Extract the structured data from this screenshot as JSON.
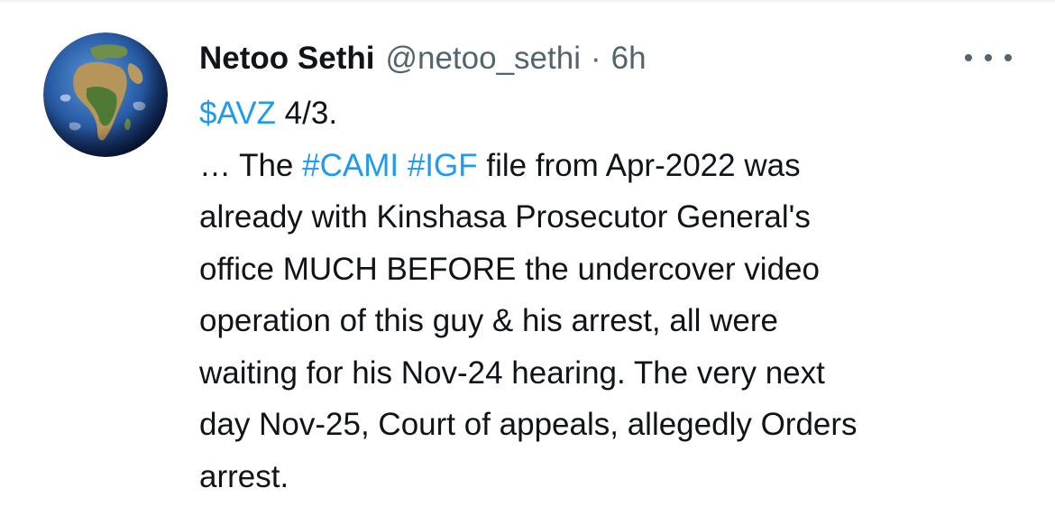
{
  "author": {
    "name": "Netoo Sethi",
    "handle": "@netoo_sethi",
    "separator": "·",
    "time": "6h"
  },
  "avatar_icon": "earth-globe-africa",
  "menu_icon": "more-horizontal-icon",
  "colors": {
    "link": "#1d9bf0",
    "text": "#0f1419",
    "secondary": "#536471"
  },
  "tweet": {
    "cashtag": "$AVZ",
    "line1_rest": " 4/3.",
    "line2_pre": "… The ",
    "hashtag1": "#CAMI",
    "line2_space": " ",
    "hashtag2": "#IGF",
    "line2_post": " file from Apr-2022 was",
    "line3": "already with Kinshasa Prosecutor General's",
    "line4": "office MUCH BEFORE the undercover video",
    "line5": "operation of this guy & his arrest, all were",
    "line6": "waiting for his Nov-24 hearing. The very next",
    "line7": "day Nov-25, Court of appeals, allegedly Orders",
    "line8": "arrest."
  }
}
